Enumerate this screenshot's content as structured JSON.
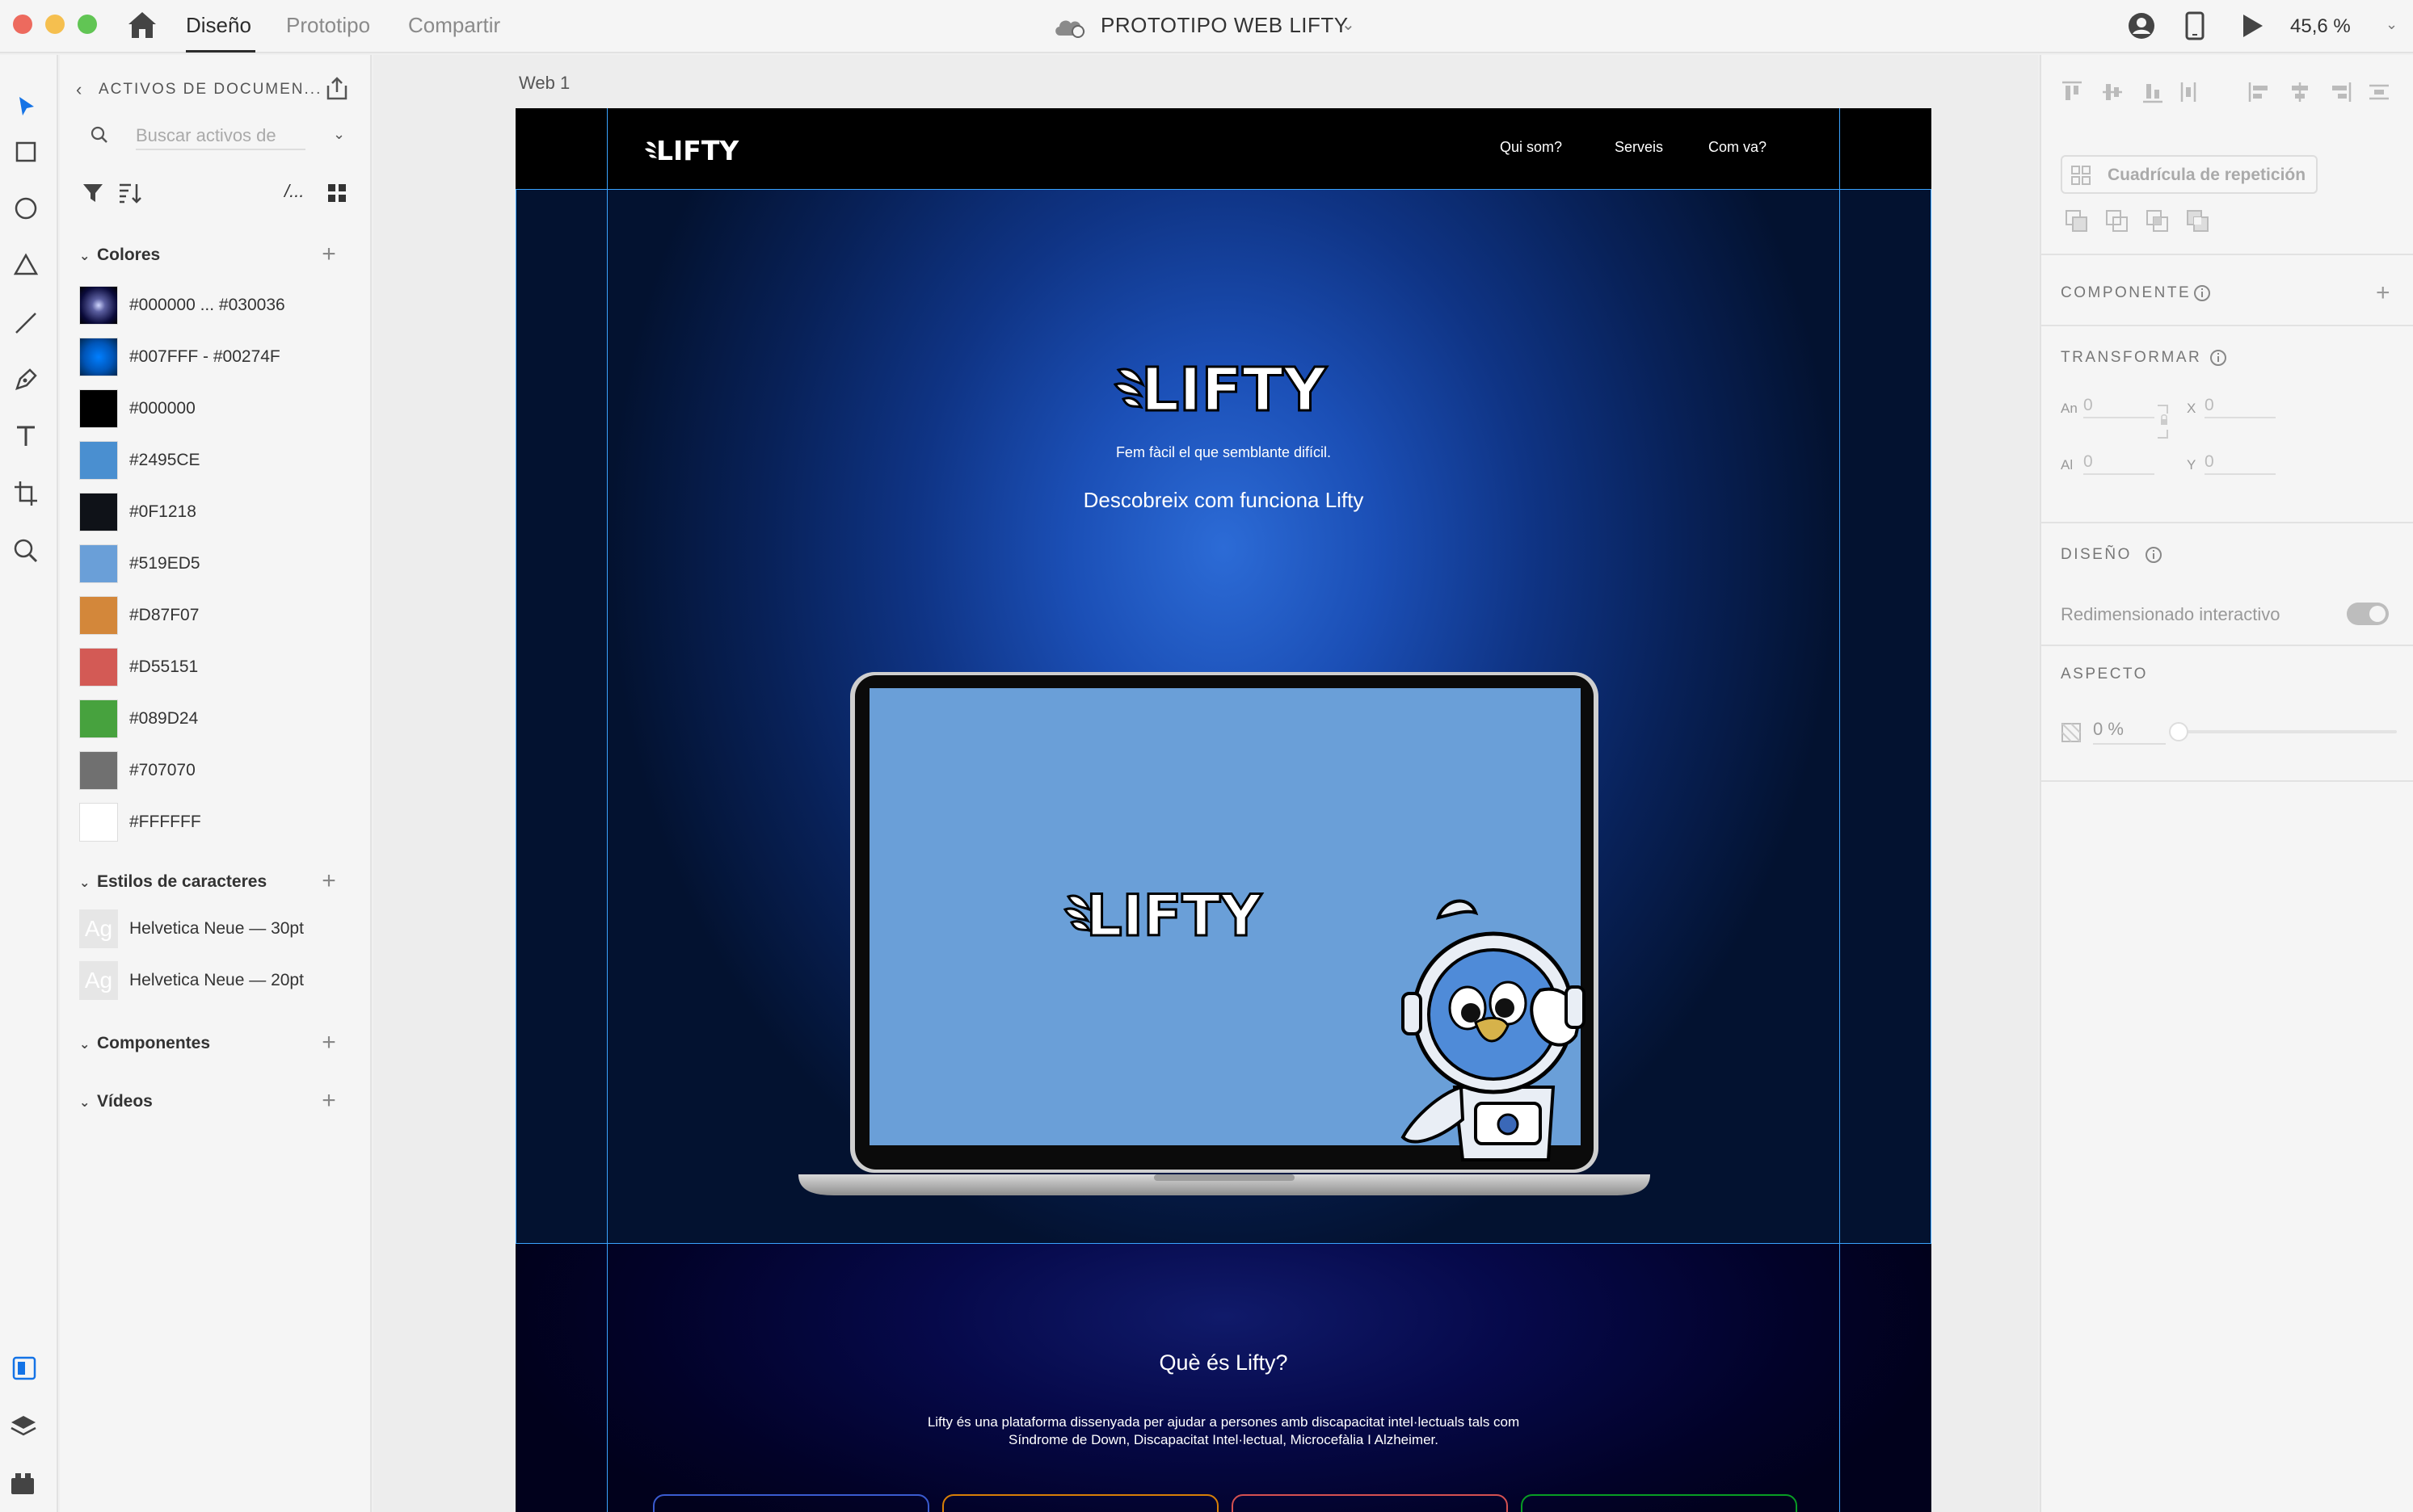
{
  "topbar": {
    "tabs": [
      "Diseño",
      "Prototipo",
      "Compartir"
    ],
    "document_title": "PROTOTIPO WEB LIFTY",
    "zoom": "45,6 %"
  },
  "assets": {
    "title": "ACTIVOS DE DOCUMEN...",
    "search_placeholder": "Buscar activos de",
    "colors_header": "Colores",
    "colors": [
      {
        "label": "#000000 ... #030036",
        "swatch": "radial-gradient(circle at 50% 50%, #cfd6ff 0%, #5b5fa0 25%, #0a0a3a 70%, #000000 100%)"
      },
      {
        "label": "#007FFF - #00274F",
        "swatch": "radial-gradient(circle at 50% 50%, #007FFF 0%, #0055b8 55%, #00274F 100%)"
      },
      {
        "label": "#000000",
        "swatch": "#000000"
      },
      {
        "label": "#2495CE",
        "swatch": "#4a8fd0"
      },
      {
        "label": "#0F1218",
        "swatch": "#0F1218"
      },
      {
        "label": "#519ED5",
        "swatch": "#6a9fd8"
      },
      {
        "label": "#D87F07",
        "swatch": "#d3873a"
      },
      {
        "label": "#D55151",
        "swatch": "#d35a55"
      },
      {
        "label": "#089D24",
        "swatch": "#47a23e"
      },
      {
        "label": "#707070",
        "swatch": "#707070"
      },
      {
        "label": "#FFFFFF",
        "swatch": "#FFFFFF"
      }
    ],
    "char_styles_header": "Estilos de caracteres",
    "char_styles": [
      {
        "sample": "Ag",
        "label": "Helvetica Neue — 30pt"
      },
      {
        "sample": "Ag",
        "label": "Helvetica Neue — 20pt"
      }
    ],
    "components_header": "Componentes",
    "videos_header": "Vídeos"
  },
  "canvas": {
    "artboard_name": "Web 1",
    "site": {
      "logo_text": "LIFTY",
      "nav": [
        "Qui som?",
        "Serveis",
        "Com va?"
      ],
      "hero_tagline": "Fem fàcil el que semblante difícil.",
      "hero_cta": "Descobreix com funciona Lifty",
      "section_title": "Què és Lifty?",
      "section_body_line1": "Lifty és una plataforma dissenyada per ajudar a persones amb discapacitat intel·lectuals tals com",
      "section_body_line2": "Síndrome de Down, Discapacitat Intel·lectual, Microcefàlia I Alzheimer.",
      "card_colors": [
        "#3a5bd0",
        "#d87f07",
        "#d55151",
        "#089d24"
      ]
    }
  },
  "inspector": {
    "repeat_grid": "Cuadrícula de repetición",
    "component_header": "COMPONENTE",
    "transform_header": "TRANSFORMAR",
    "fields": {
      "width_label": "An",
      "width_value": "0",
      "x_label": "X",
      "x_value": "0",
      "height_label": "Al",
      "height_value": "0",
      "y_label": "Y",
      "y_value": "0"
    },
    "layout_header": "DISEÑO",
    "responsive_resize": "Redimensionado interactivo",
    "appearance_header": "ASPECTO",
    "opacity": "0 %"
  }
}
